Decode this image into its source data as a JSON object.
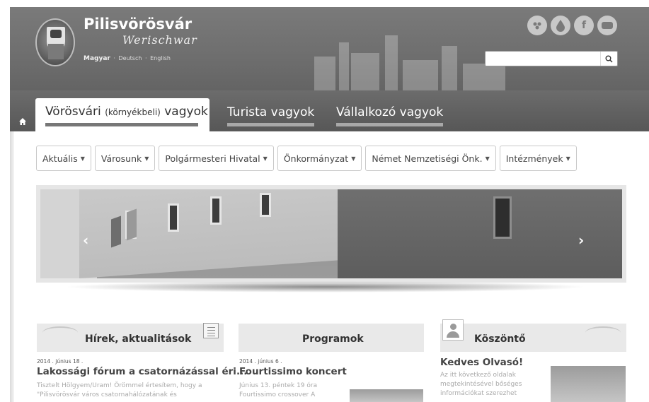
{
  "header": {
    "site_title": "Pilisvörösvár",
    "site_subtitle": "Werischwar",
    "languages": {
      "active": "Magyar",
      "others": [
        "Deutsch",
        "English"
      ],
      "separator": "·"
    },
    "social_icons": [
      "flickr-icon",
      "drop-icon",
      "facebook-icon",
      "youtube-icon"
    ],
    "search": {
      "placeholder": "",
      "value": ""
    }
  },
  "tabs": {
    "active": {
      "main1": "Vörösvári",
      "small": "(környékbeli)",
      "main2": "vagyok"
    },
    "t2": "Turista vagyok",
    "t3": "Vállalkozó vagyok"
  },
  "menu": {
    "items": [
      "Aktuális",
      "Városunk",
      "Polgármesteri Hivatal",
      "Önkormányzat",
      "Német Nemzetiségi Önk.",
      "Intézmények"
    ]
  },
  "columns": {
    "news": {
      "title": "Hírek, aktualitások",
      "date": "2014 . június 18 .",
      "headline": "Lakossági fórum a csatornázással éri...",
      "text_line1": "Tisztelt Hölgyem/Uram! Örömmel értesítem, hogy a",
      "text_line2": "\"Pilisvörösvár város csatornahálózatának és"
    },
    "programs": {
      "title": "Programok",
      "date": "2014 . június 6 .",
      "headline": "Fourtissimo koncert",
      "text_line1": "Június 13. péntek 19 óra",
      "text_line2": "Fourtissimo crossover A"
    },
    "greeting": {
      "title": "Köszöntő",
      "headline": "Kedves Olvasó!",
      "text_line1": "Az itt következő oldalak",
      "text_line2": "megtekintésével bőséges",
      "text_line3": "információkat szerezhet"
    }
  },
  "colors": {
    "header_bg": "#707070",
    "tab_bar": "#5e5e5e",
    "panel_bg": "#e9e9e9"
  }
}
